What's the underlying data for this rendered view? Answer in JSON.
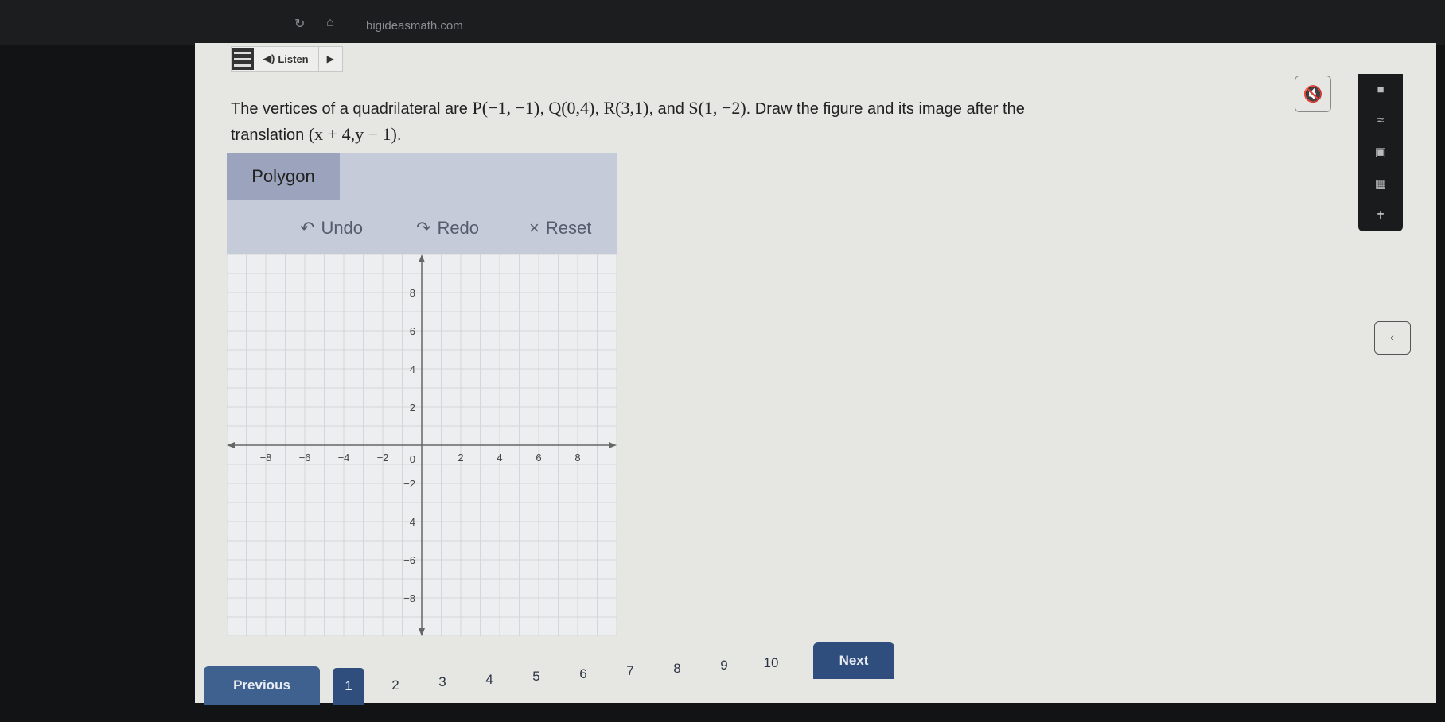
{
  "browser": {
    "url": "bigideasmath.com"
  },
  "toolbar": {
    "listen_label": "Listen"
  },
  "question": {
    "text_before": "The vertices of a quadrilateral are ",
    "P": "P(−1, −1)",
    "Q": "Q(0,4)",
    "R": "R(3,1)",
    "and": ", and ",
    "S": "S(1, −2)",
    "text_after": ". Draw the figure and its image after the",
    "line2": "translation ",
    "rule": "(x + 4,y − 1)",
    "end": "."
  },
  "graph_panel": {
    "mode_label": "Polygon",
    "undo_label": "Undo",
    "redo_label": "Redo",
    "reset_label": "Reset"
  },
  "grid": {
    "xlim": [
      -10,
      10
    ],
    "ylim": [
      -10,
      10
    ],
    "x_ticks": [
      "−8",
      "−6",
      "−4",
      "−2",
      "2",
      "4",
      "6",
      "8"
    ],
    "y_ticks": [
      "8",
      "6",
      "4",
      "2",
      "−2",
      "−4",
      "−6",
      "−8"
    ],
    "origin_label": "0"
  },
  "sidebar": {
    "icons": [
      "square-icon",
      "calculator-icon",
      "notepad-icon",
      "calendar-icon",
      "accessibility-icon"
    ]
  },
  "pagination": {
    "previous_label": "Previous",
    "next_label": "Next",
    "pages": [
      "1",
      "2",
      "3",
      "4",
      "5",
      "6",
      "7",
      "8",
      "9",
      "10"
    ],
    "current": "1"
  },
  "colors": {
    "primary": "#2f4e7e",
    "panel": "#c5cbd9"
  }
}
